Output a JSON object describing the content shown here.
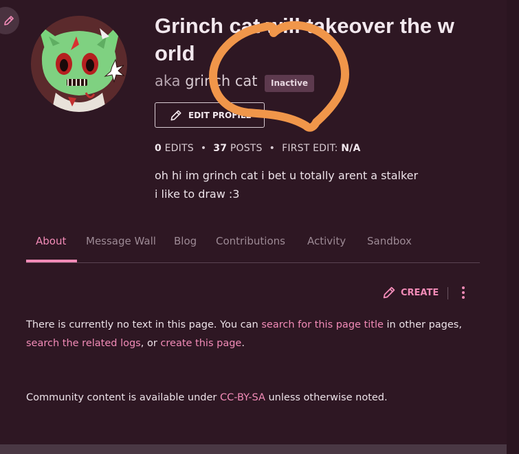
{
  "profile": {
    "title": "Grinch cat will takeover the w orld",
    "aka_prefix": "aka",
    "aka_name": "grinch cat",
    "status_badge": "Inactive",
    "edit_profile_label": "EDIT PROFILE",
    "stats": {
      "edits_count": "0",
      "edits_label": "EDITS",
      "posts_count": "37",
      "posts_label": "POSTS",
      "first_edit_label": "FIRST EDIT:",
      "first_edit_value": "N/A"
    },
    "bio_lines": [
      "oh hi im grinch cat i bet u totally arent a stalker",
      "i like to draw :3"
    ]
  },
  "tabs": [
    {
      "label": "About",
      "active": true
    },
    {
      "label": "Message Wall",
      "active": false
    },
    {
      "label": "Blog",
      "active": false
    },
    {
      "label": "Contributions",
      "active": false
    },
    {
      "label": "Activity",
      "active": false
    },
    {
      "label": "Sandbox",
      "active": false
    }
  ],
  "toolbar": {
    "create_label": "CREATE",
    "more_icon": "kebab-menu-icon"
  },
  "notice": {
    "text_1": "There is currently no text in this page. You can",
    "link_search": "search for this page title",
    "text_2": "in other pages,",
    "link_logs": "search the related logs",
    "text_3": ", or",
    "link_create": "create this page",
    "text_4": "."
  },
  "license": {
    "text_1": "Community content is available under",
    "link": "CC-BY-SA",
    "text_2": "unless otherwise noted."
  },
  "icons": {
    "edit_fab": "pencil-icon",
    "edit_profile": "pencil-icon",
    "create": "pencil-icon"
  },
  "colors": {
    "background": "#2e1723",
    "accent": "#f28bb7",
    "badge_bg": "#5d3a4e",
    "annotation": "#f0964a"
  }
}
